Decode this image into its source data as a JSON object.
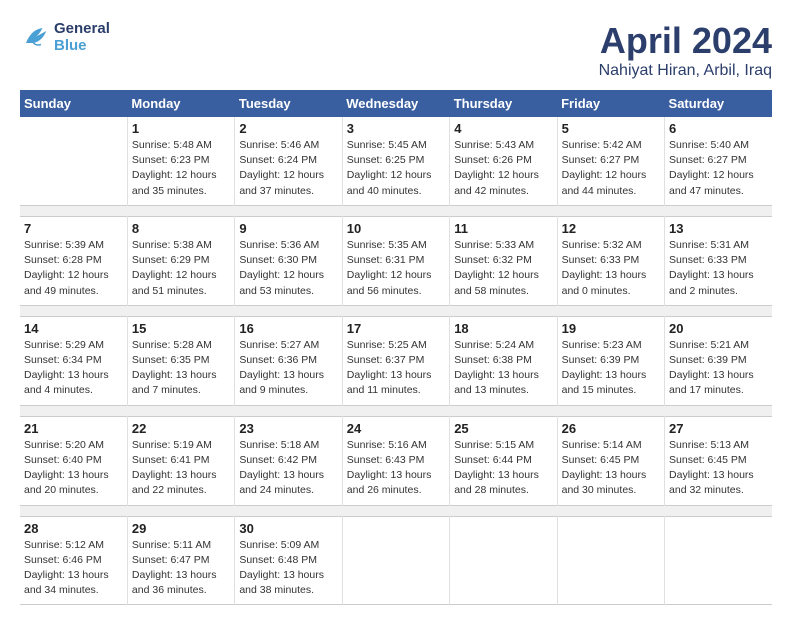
{
  "header": {
    "logo_line1": "General",
    "logo_line2": "Blue",
    "month_year": "April 2024",
    "location": "Nahiyat Hiran, Arbil, Iraq"
  },
  "weekdays": [
    "Sunday",
    "Monday",
    "Tuesday",
    "Wednesday",
    "Thursday",
    "Friday",
    "Saturday"
  ],
  "weeks": [
    [
      {
        "day": "",
        "sunrise": "",
        "sunset": "",
        "daylight": ""
      },
      {
        "day": "1",
        "sunrise": "Sunrise: 5:48 AM",
        "sunset": "Sunset: 6:23 PM",
        "daylight": "Daylight: 12 hours and 35 minutes."
      },
      {
        "day": "2",
        "sunrise": "Sunrise: 5:46 AM",
        "sunset": "Sunset: 6:24 PM",
        "daylight": "Daylight: 12 hours and 37 minutes."
      },
      {
        "day": "3",
        "sunrise": "Sunrise: 5:45 AM",
        "sunset": "Sunset: 6:25 PM",
        "daylight": "Daylight: 12 hours and 40 minutes."
      },
      {
        "day": "4",
        "sunrise": "Sunrise: 5:43 AM",
        "sunset": "Sunset: 6:26 PM",
        "daylight": "Daylight: 12 hours and 42 minutes."
      },
      {
        "day": "5",
        "sunrise": "Sunrise: 5:42 AM",
        "sunset": "Sunset: 6:27 PM",
        "daylight": "Daylight: 12 hours and 44 minutes."
      },
      {
        "day": "6",
        "sunrise": "Sunrise: 5:40 AM",
        "sunset": "Sunset: 6:27 PM",
        "daylight": "Daylight: 12 hours and 47 minutes."
      }
    ],
    [
      {
        "day": "7",
        "sunrise": "Sunrise: 5:39 AM",
        "sunset": "Sunset: 6:28 PM",
        "daylight": "Daylight: 12 hours and 49 minutes."
      },
      {
        "day": "8",
        "sunrise": "Sunrise: 5:38 AM",
        "sunset": "Sunset: 6:29 PM",
        "daylight": "Daylight: 12 hours and 51 minutes."
      },
      {
        "day": "9",
        "sunrise": "Sunrise: 5:36 AM",
        "sunset": "Sunset: 6:30 PM",
        "daylight": "Daylight: 12 hours and 53 minutes."
      },
      {
        "day": "10",
        "sunrise": "Sunrise: 5:35 AM",
        "sunset": "Sunset: 6:31 PM",
        "daylight": "Daylight: 12 hours and 56 minutes."
      },
      {
        "day": "11",
        "sunrise": "Sunrise: 5:33 AM",
        "sunset": "Sunset: 6:32 PM",
        "daylight": "Daylight: 12 hours and 58 minutes."
      },
      {
        "day": "12",
        "sunrise": "Sunrise: 5:32 AM",
        "sunset": "Sunset: 6:33 PM",
        "daylight": "Daylight: 13 hours and 0 minutes."
      },
      {
        "day": "13",
        "sunrise": "Sunrise: 5:31 AM",
        "sunset": "Sunset: 6:33 PM",
        "daylight": "Daylight: 13 hours and 2 minutes."
      }
    ],
    [
      {
        "day": "14",
        "sunrise": "Sunrise: 5:29 AM",
        "sunset": "Sunset: 6:34 PM",
        "daylight": "Daylight: 13 hours and 4 minutes."
      },
      {
        "day": "15",
        "sunrise": "Sunrise: 5:28 AM",
        "sunset": "Sunset: 6:35 PM",
        "daylight": "Daylight: 13 hours and 7 minutes."
      },
      {
        "day": "16",
        "sunrise": "Sunrise: 5:27 AM",
        "sunset": "Sunset: 6:36 PM",
        "daylight": "Daylight: 13 hours and 9 minutes."
      },
      {
        "day": "17",
        "sunrise": "Sunrise: 5:25 AM",
        "sunset": "Sunset: 6:37 PM",
        "daylight": "Daylight: 13 hours and 11 minutes."
      },
      {
        "day": "18",
        "sunrise": "Sunrise: 5:24 AM",
        "sunset": "Sunset: 6:38 PM",
        "daylight": "Daylight: 13 hours and 13 minutes."
      },
      {
        "day": "19",
        "sunrise": "Sunrise: 5:23 AM",
        "sunset": "Sunset: 6:39 PM",
        "daylight": "Daylight: 13 hours and 15 minutes."
      },
      {
        "day": "20",
        "sunrise": "Sunrise: 5:21 AM",
        "sunset": "Sunset: 6:39 PM",
        "daylight": "Daylight: 13 hours and 17 minutes."
      }
    ],
    [
      {
        "day": "21",
        "sunrise": "Sunrise: 5:20 AM",
        "sunset": "Sunset: 6:40 PM",
        "daylight": "Daylight: 13 hours and 20 minutes."
      },
      {
        "day": "22",
        "sunrise": "Sunrise: 5:19 AM",
        "sunset": "Sunset: 6:41 PM",
        "daylight": "Daylight: 13 hours and 22 minutes."
      },
      {
        "day": "23",
        "sunrise": "Sunrise: 5:18 AM",
        "sunset": "Sunset: 6:42 PM",
        "daylight": "Daylight: 13 hours and 24 minutes."
      },
      {
        "day": "24",
        "sunrise": "Sunrise: 5:16 AM",
        "sunset": "Sunset: 6:43 PM",
        "daylight": "Daylight: 13 hours and 26 minutes."
      },
      {
        "day": "25",
        "sunrise": "Sunrise: 5:15 AM",
        "sunset": "Sunset: 6:44 PM",
        "daylight": "Daylight: 13 hours and 28 minutes."
      },
      {
        "day": "26",
        "sunrise": "Sunrise: 5:14 AM",
        "sunset": "Sunset: 6:45 PM",
        "daylight": "Daylight: 13 hours and 30 minutes."
      },
      {
        "day": "27",
        "sunrise": "Sunrise: 5:13 AM",
        "sunset": "Sunset: 6:45 PM",
        "daylight": "Daylight: 13 hours and 32 minutes."
      }
    ],
    [
      {
        "day": "28",
        "sunrise": "Sunrise: 5:12 AM",
        "sunset": "Sunset: 6:46 PM",
        "daylight": "Daylight: 13 hours and 34 minutes."
      },
      {
        "day": "29",
        "sunrise": "Sunrise: 5:11 AM",
        "sunset": "Sunset: 6:47 PM",
        "daylight": "Daylight: 13 hours and 36 minutes."
      },
      {
        "day": "30",
        "sunrise": "Sunrise: 5:09 AM",
        "sunset": "Sunset: 6:48 PM",
        "daylight": "Daylight: 13 hours and 38 minutes."
      },
      {
        "day": "",
        "sunrise": "",
        "sunset": "",
        "daylight": ""
      },
      {
        "day": "",
        "sunrise": "",
        "sunset": "",
        "daylight": ""
      },
      {
        "day": "",
        "sunrise": "",
        "sunset": "",
        "daylight": ""
      },
      {
        "day": "",
        "sunrise": "",
        "sunset": "",
        "daylight": ""
      }
    ]
  ]
}
